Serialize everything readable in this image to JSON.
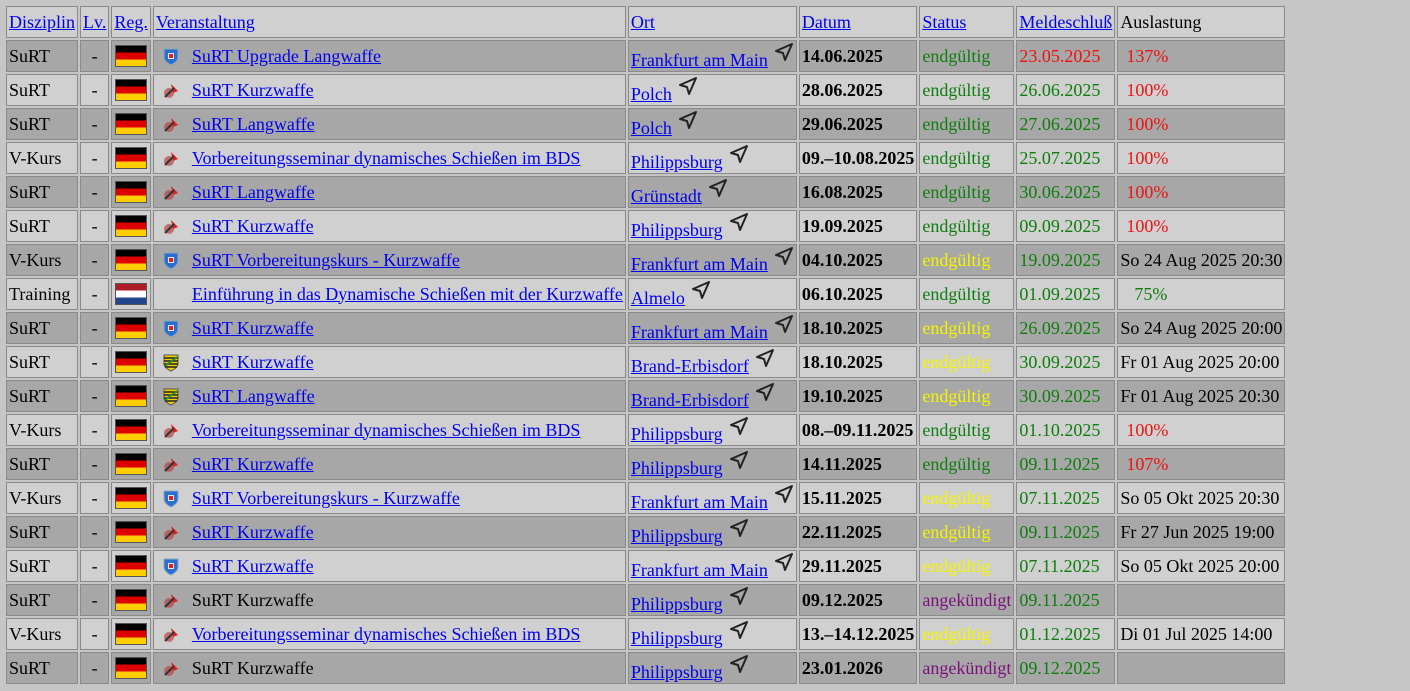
{
  "headers": {
    "disziplin": "Disziplin",
    "lv": "Lv.",
    "reg": "Reg.",
    "veranstaltung": "Veranstaltung",
    "ort": "Ort",
    "datum": "Datum",
    "status": "Status",
    "meldeschluss": "Meldeschluß",
    "auslastung": "Auslastung"
  },
  "colors": {
    "status_green": "#0f7d0f",
    "status_yellow": "#f5f500",
    "status_purple": "#7d0f7d",
    "deadline_red": "#ee1111",
    "link_blue": "#0000ee"
  },
  "rows": [
    {
      "disziplin": "SuRT",
      "lv": "-",
      "flag": "de-flag-icon",
      "logo": "hessen-shield-icon",
      "veranstaltung": "SuRT Upgrade Langwaffe",
      "linked": true,
      "ort": "Frankfurt am Main",
      "datum": "14.06.2025",
      "status": "endgültig",
      "status_color": "green",
      "meldeschluss": "23.05.2025",
      "ms_color": "red",
      "auslastung": "137%",
      "au_color": "red"
    },
    {
      "disziplin": "SuRT",
      "lv": "-",
      "flag": "de-flag-icon",
      "logo": "bds-logo-icon",
      "veranstaltung": "SuRT Kurzwaffe",
      "linked": true,
      "ort": "Polch",
      "datum": "28.06.2025",
      "status": "endgültig",
      "status_color": "green",
      "meldeschluss": "26.06.2025",
      "ms_color": "green",
      "auslastung": "100%",
      "au_color": "red"
    },
    {
      "disziplin": "SuRT",
      "lv": "-",
      "flag": "de-flag-icon",
      "logo": "bds-logo-icon",
      "veranstaltung": "SuRT Langwaffe",
      "linked": true,
      "ort": "Polch",
      "datum": "29.06.2025",
      "status": "endgültig",
      "status_color": "green",
      "meldeschluss": "27.06.2025",
      "ms_color": "green",
      "auslastung": "100%",
      "au_color": "red"
    },
    {
      "disziplin": "V-Kurs",
      "lv": "-",
      "flag": "de-flag-icon",
      "logo": "bds-logo-icon",
      "veranstaltung": "Vorbereitungsseminar dynamisches Schießen im BDS",
      "linked": true,
      "ort": "Philippsburg",
      "datum": "09.–10.08.2025",
      "status": "endgültig",
      "status_color": "green",
      "meldeschluss": "25.07.2025",
      "ms_color": "green",
      "auslastung": "100%",
      "au_color": "red"
    },
    {
      "disziplin": "SuRT",
      "lv": "-",
      "flag": "de-flag-icon",
      "logo": "bds-logo-icon",
      "veranstaltung": "SuRT Langwaffe",
      "linked": true,
      "ort": "Grünstadt",
      "datum": "16.08.2025",
      "status": "endgültig",
      "status_color": "green",
      "meldeschluss": "30.06.2025",
      "ms_color": "green",
      "auslastung": "100%",
      "au_color": "red"
    },
    {
      "disziplin": "SuRT",
      "lv": "-",
      "flag": "de-flag-icon",
      "logo": "bds-logo-icon",
      "veranstaltung": "SuRT Kurzwaffe",
      "linked": true,
      "ort": "Philippsburg",
      "datum": "19.09.2025",
      "status": "endgültig",
      "status_color": "green",
      "meldeschluss": "09.09.2025",
      "ms_color": "green",
      "auslastung": "100%",
      "au_color": "red"
    },
    {
      "disziplin": "V-Kurs",
      "lv": "-",
      "flag": "de-flag-icon",
      "logo": "hessen-shield-icon",
      "veranstaltung": "SuRT Vorbereitungskurs - Kurzwaffe",
      "linked": true,
      "ort": "Frankfurt am Main",
      "datum": "04.10.2025",
      "status": "endgültig",
      "status_color": "yellow",
      "meldeschluss": "19.09.2025",
      "ms_color": "green",
      "auslastung": "So 24 Aug 2025 20:30",
      "au_color": "time"
    },
    {
      "disziplin": "Training",
      "lv": "-",
      "flag": "nl-flag-icon",
      "logo": "",
      "veranstaltung": "Einführung in das Dynamische Schießen mit der Kurzwaffe",
      "linked": true,
      "ort": "Almelo",
      "datum": "06.10.2025",
      "status": "endgültig",
      "status_color": "green",
      "meldeschluss": "01.09.2025",
      "ms_color": "green",
      "auslastung": "75%",
      "au_color": "green"
    },
    {
      "disziplin": "SuRT",
      "lv": "-",
      "flag": "de-flag-icon",
      "logo": "hessen-shield-icon",
      "veranstaltung": "SuRT Kurzwaffe",
      "linked": true,
      "ort": "Frankfurt am Main",
      "datum": "18.10.2025",
      "status": "endgültig",
      "status_color": "yellow",
      "meldeschluss": "26.09.2025",
      "ms_color": "green",
      "auslastung": "So 24 Aug 2025 20:00",
      "au_color": "time"
    },
    {
      "disziplin": "SuRT",
      "lv": "-",
      "flag": "de-flag-icon",
      "logo": "saxony-shield-icon",
      "veranstaltung": "SuRT Kurzwaffe",
      "linked": true,
      "ort": "Brand-Erbisdorf",
      "datum": "18.10.2025",
      "status": "endgültig",
      "status_color": "yellow",
      "meldeschluss": "30.09.2025",
      "ms_color": "green",
      "auslastung": "Fr 01 Aug 2025 20:00",
      "au_color": "time"
    },
    {
      "disziplin": "SuRT",
      "lv": "-",
      "flag": "de-flag-icon",
      "logo": "saxony-shield-icon",
      "veranstaltung": "SuRT Langwaffe",
      "linked": true,
      "ort": "Brand-Erbisdorf",
      "datum": "19.10.2025",
      "status": "endgültig",
      "status_color": "yellow",
      "meldeschluss": "30.09.2025",
      "ms_color": "green",
      "auslastung": "Fr 01 Aug 2025 20:30",
      "au_color": "time"
    },
    {
      "disziplin": "V-Kurs",
      "lv": "-",
      "flag": "de-flag-icon",
      "logo": "bds-logo-icon",
      "veranstaltung": "Vorbereitungsseminar dynamisches Schießen im BDS",
      "linked": true,
      "ort": "Philippsburg",
      "datum": "08.–09.11.2025",
      "status": "endgültig",
      "status_color": "green",
      "meldeschluss": "01.10.2025",
      "ms_color": "green",
      "auslastung": "100%",
      "au_color": "red"
    },
    {
      "disziplin": "SuRT",
      "lv": "-",
      "flag": "de-flag-icon",
      "logo": "bds-logo-icon",
      "veranstaltung": "SuRT Kurzwaffe",
      "linked": true,
      "ort": "Philippsburg",
      "datum": "14.11.2025",
      "status": "endgültig",
      "status_color": "green",
      "meldeschluss": "09.11.2025",
      "ms_color": "green",
      "auslastung": "107%",
      "au_color": "red"
    },
    {
      "disziplin": "V-Kurs",
      "lv": "-",
      "flag": "de-flag-icon",
      "logo": "hessen-shield-icon",
      "veranstaltung": "SuRT Vorbereitungskurs - Kurzwaffe",
      "linked": true,
      "ort": "Frankfurt am Main",
      "datum": "15.11.2025",
      "status": "endgültig",
      "status_color": "yellow",
      "meldeschluss": "07.11.2025",
      "ms_color": "green",
      "auslastung": "So 05 Okt 2025 20:30",
      "au_color": "time"
    },
    {
      "disziplin": "SuRT",
      "lv": "-",
      "flag": "de-flag-icon",
      "logo": "bds-logo-icon",
      "veranstaltung": "SuRT Kurzwaffe",
      "linked": true,
      "ort": "Philippsburg",
      "datum": "22.11.2025",
      "status": "endgültig",
      "status_color": "yellow",
      "meldeschluss": "09.11.2025",
      "ms_color": "green",
      "auslastung": "Fr 27 Jun 2025 19:00",
      "au_color": "time"
    },
    {
      "disziplin": "SuRT",
      "lv": "-",
      "flag": "de-flag-icon",
      "logo": "hessen-shield-icon",
      "veranstaltung": "SuRT Kurzwaffe",
      "linked": true,
      "ort": "Frankfurt am Main",
      "datum": "29.11.2025",
      "status": "endgültig",
      "status_color": "yellow",
      "meldeschluss": "07.11.2025",
      "ms_color": "green",
      "auslastung": "So 05 Okt 2025 20:00",
      "au_color": "time"
    },
    {
      "disziplin": "SuRT",
      "lv": "-",
      "flag": "de-flag-icon",
      "logo": "bds-logo-icon",
      "veranstaltung": "SuRT Kurzwaffe",
      "linked": false,
      "ort": "Philippsburg",
      "datum": "09.12.2025",
      "status": "angekündigt",
      "status_color": "purple",
      "meldeschluss": "09.11.2025",
      "ms_color": "green",
      "auslastung": "",
      "au_color": "time"
    },
    {
      "disziplin": "V-Kurs",
      "lv": "-",
      "flag": "de-flag-icon",
      "logo": "bds-logo-icon",
      "veranstaltung": "Vorbereitungsseminar dynamisches Schießen im BDS",
      "linked": true,
      "ort": "Philippsburg",
      "datum": "13.–14.12.2025",
      "status": "endgültig",
      "status_color": "yellow",
      "meldeschluss": "01.12.2025",
      "ms_color": "green",
      "auslastung": "Di 01 Jul 2025 14:00",
      "au_color": "time"
    },
    {
      "disziplin": "SuRT",
      "lv": "-",
      "flag": "de-flag-icon",
      "logo": "bds-logo-icon",
      "veranstaltung": "SuRT Kurzwaffe",
      "linked": false,
      "ort": "Philippsburg",
      "datum": "23.01.2026",
      "status": "angekündigt",
      "status_color": "purple",
      "meldeschluss": "09.12.2025",
      "ms_color": "green",
      "auslastung": "",
      "au_color": "time"
    }
  ]
}
